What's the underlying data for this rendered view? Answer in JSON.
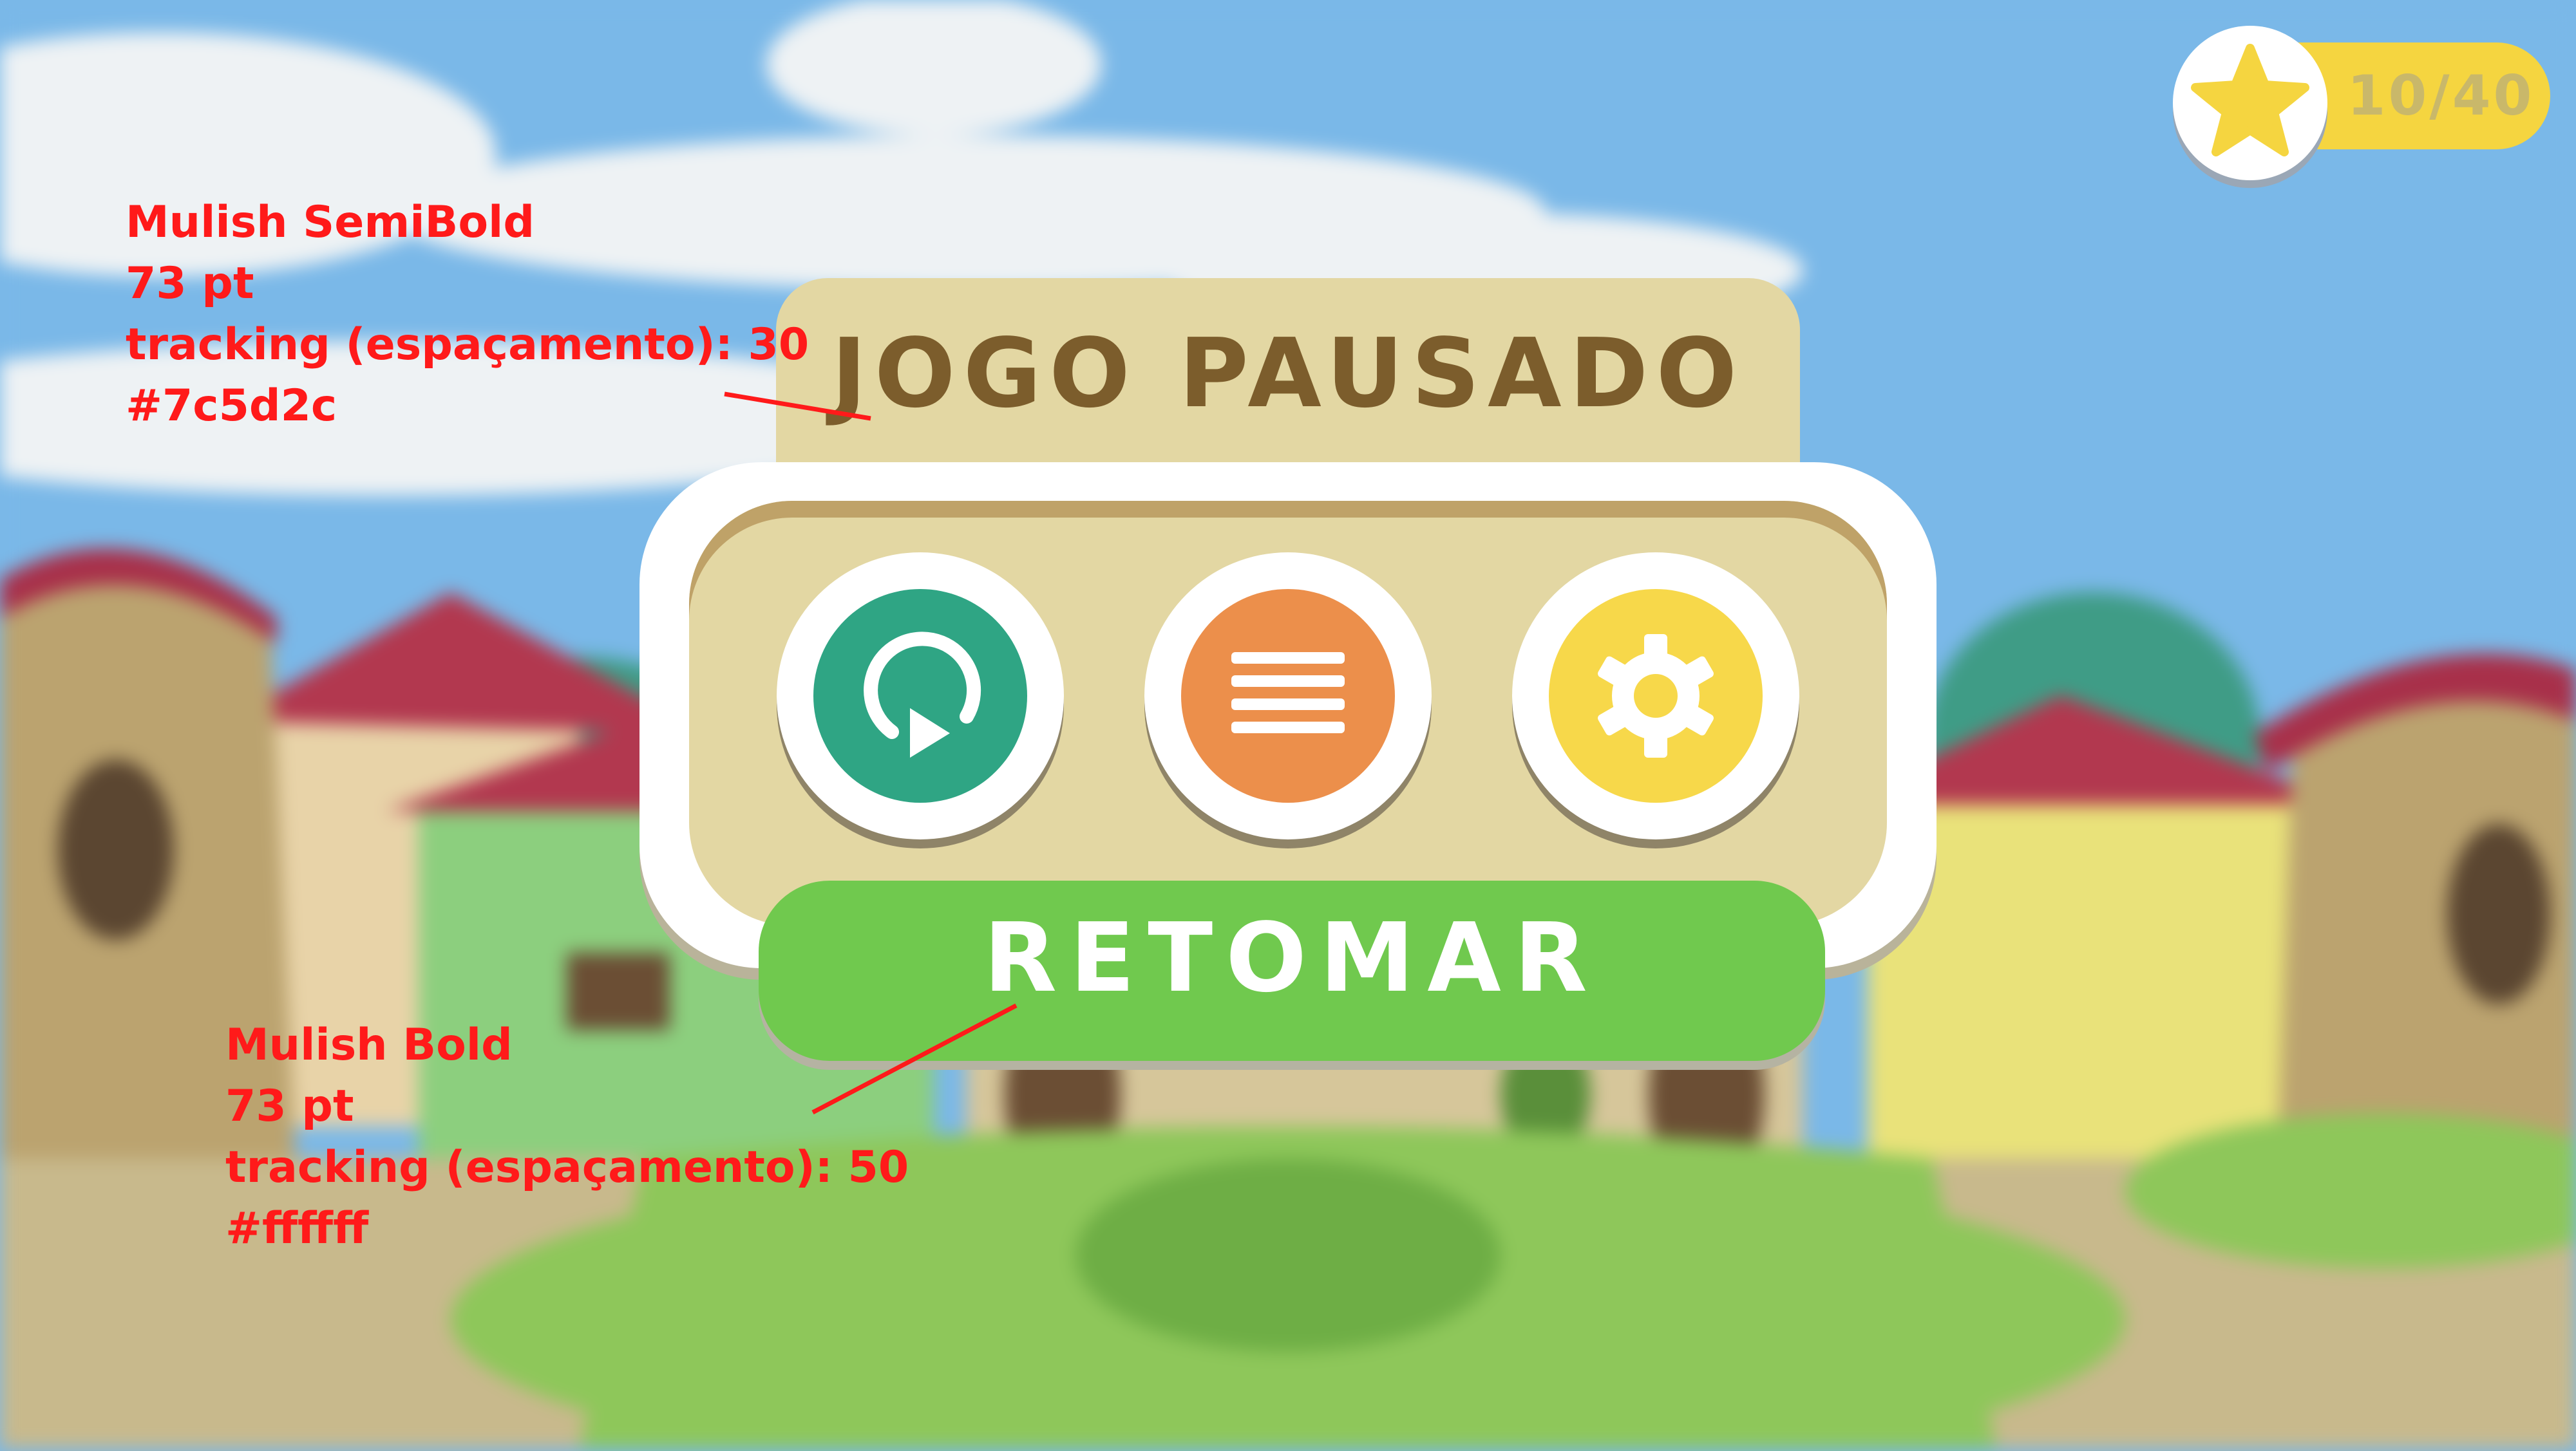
{
  "score": {
    "text": "10/40",
    "icon": "star-icon",
    "pill_color": "#f5d540",
    "star_color": "#f5d540"
  },
  "dialog": {
    "title": "JOGO PAUSADO",
    "title_color": "#7c5d2c",
    "panel_color": "#e3d7a3",
    "buttons": [
      {
        "name": "restart",
        "icon": "restart-icon",
        "color": "#2fa584"
      },
      {
        "name": "menu",
        "icon": "menu-icon",
        "color": "#ec8f4b"
      },
      {
        "name": "settings",
        "icon": "gear-icon",
        "color": "#f7d84a"
      }
    ],
    "resume_label": "RETOMAR",
    "resume_color": "#70c94e"
  },
  "annotations": {
    "title_note": {
      "font": "Mulish SemiBold",
      "size": "73 pt",
      "tracking": "tracking (espaçamento): 30",
      "color": "#7c5d2c"
    },
    "resume_note": {
      "font": "Mulish Bold",
      "size": "73 pt",
      "tracking": "tracking (espaçamento): 50",
      "color": "#ffffff"
    }
  }
}
